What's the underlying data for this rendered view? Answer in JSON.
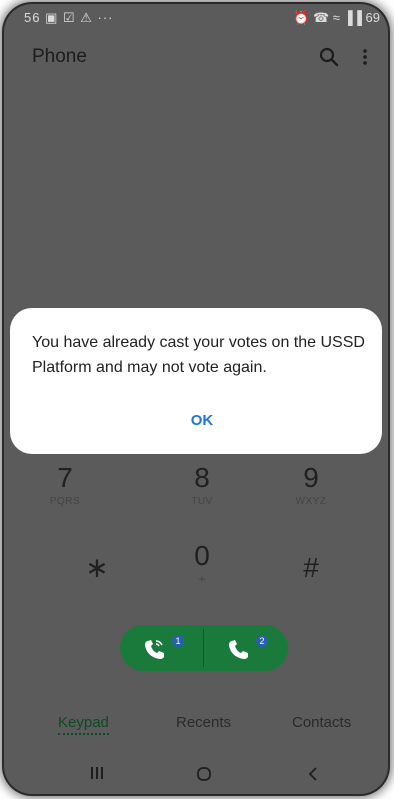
{
  "status_bar": {
    "left": "56 ▣ ☑ ⚠ ···",
    "right": "⏰ ☎ ≈ ▐▐ 69"
  },
  "app_bar": {
    "title": "Phone"
  },
  "dialog": {
    "message": "You have already cast your votes on the USSD Platform and may not vote again.",
    "ok_label": "OK"
  },
  "keypad": {
    "keys": [
      {
        "digit": "7",
        "letters": "PQRS"
      },
      {
        "digit": "8",
        "letters": "TUV"
      },
      {
        "digit": "9",
        "letters": "WXYZ"
      },
      {
        "digit": "∗",
        "letters": ""
      },
      {
        "digit": "0",
        "letters": "+"
      },
      {
        "digit": "#",
        "letters": ""
      }
    ]
  },
  "call": {
    "sim1_label": "1",
    "sim2_label": "2"
  },
  "tabs": [
    {
      "label": "Keypad",
      "active": true
    },
    {
      "label": "Recents",
      "active": false
    },
    {
      "label": "Contacts",
      "active": false
    }
  ],
  "nav": {
    "recents_glyph": "|||",
    "home_glyph": "○",
    "back_glyph": "<"
  }
}
